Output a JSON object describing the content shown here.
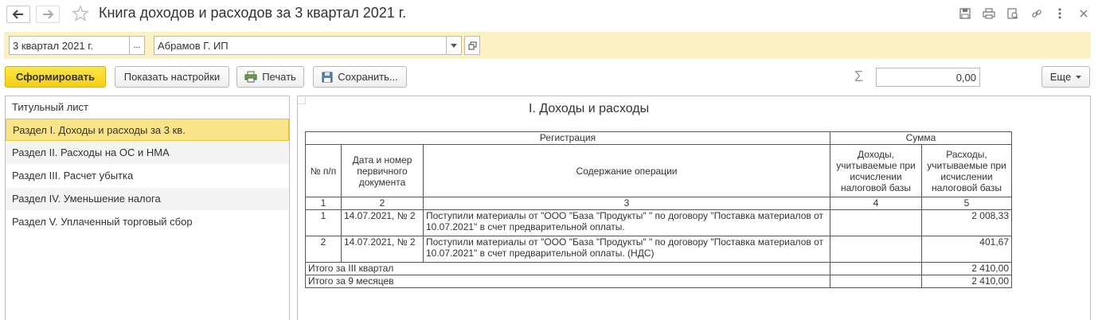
{
  "window": {
    "title": "Книга доходов и расходов за 3 квартал 2021 г."
  },
  "params": {
    "period_value": "3 квартал 2021 г.",
    "period_select_label": "...",
    "org_value": "Абрамов Г. ИП"
  },
  "toolbar": {
    "generate_label": "Сформировать",
    "settings_label": "Показать настройки",
    "print_label": "Печать",
    "save_label": "Сохранить...",
    "sum_value": "0,00",
    "more_label": "Еще"
  },
  "sections": [
    {
      "label": "Титульный лист"
    },
    {
      "label": "Раздел I. Доходы и расходы за 3 кв."
    },
    {
      "label": "Раздел II. Расходы на ОС и НМА"
    },
    {
      "label": "Раздел III. Расчет убытка"
    },
    {
      "label": "Раздел IV. Уменьшение налога"
    },
    {
      "label": "Раздел V. Уплаченный торговый сбор"
    }
  ],
  "report": {
    "title": "I. Доходы и расходы",
    "header": {
      "registration": "Регистрация",
      "sum": "Сумма",
      "num": "№ п/п",
      "date_doc": "Дата и номер первичного документа",
      "content": "Содержание операции",
      "income": "Доходы, учитываемые при исчислении налоговой базы",
      "expense": "Расходы, учитываемые при исчислении налоговой базы"
    },
    "col_numbers": [
      "1",
      "2",
      "3",
      "4",
      "5"
    ],
    "rows": [
      {
        "num": "1",
        "date_doc": "14.07.2021, № 2",
        "content": "Поступили материалы от \"ООО \"База \"Продукты\" \" по договору \"Поставка материалов от 10.07.2021\" в счет предварительной оплаты.",
        "income": "",
        "expense": "2 008,33"
      },
      {
        "num": "2",
        "date_doc": "14.07.2021, № 2",
        "content": "Поступили материалы от \"ООО \"База \"Продукты\" \" по договору \"Поставка материалов от 10.07.2021\" в счет предварительной оплаты. (НДС)",
        "income": "",
        "expense": "401,67"
      }
    ],
    "totals": [
      {
        "label": "Итого за III квартал",
        "income": "",
        "expense": "2 410,00"
      },
      {
        "label": "Итого за 9 месяцев",
        "income": "",
        "expense": "2 410,00"
      }
    ]
  }
}
